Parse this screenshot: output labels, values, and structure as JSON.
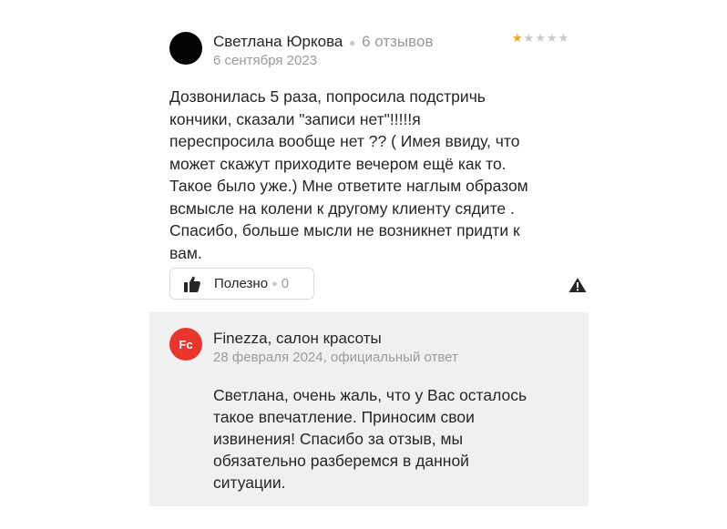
{
  "review": {
    "author_name": "Светлана Юркова",
    "review_count": "6 отзывов",
    "date": "6 сентября 2023",
    "rating": 1,
    "rating_max": 5,
    "text": "Дозвонилась 5 раза, попросила подстричь\nкончики, сказали \"записи нет\"!!!!!я\nпереспросила вообще нет ?? ( Имея ввиду, что\nможет скажут приходите вечером ещё как то.\nТакое было уже.) Мне ответите наглым образом\nвсмысле на колени к другому клиенту сядите .\nСпасибо, больше мысли не возникнет придти к\nвам.",
    "useful_label": "Полезно",
    "useful_count": "0",
    "icons": {
      "useful": "thumbs-up-icon",
      "report": "warning-triangle-icon"
    }
  },
  "reply": {
    "logo_text": "Fc",
    "business_name": "Finezza, салон красоты",
    "meta": "28 февраля 2024, официальный ответ",
    "text": "Светлана, очень жаль, что у Вас осталось\nтакое впечатление. Приносим свои\nизвинения! Спасибо за отзыв, мы\nобязательно разберемся в данной\nситуации."
  },
  "colors": {
    "star_filled": "#f6a31c",
    "star_empty": "#c9c9c9",
    "logo_bg": "#e8362d",
    "reply_bg": "#f0f0f0",
    "secondary_text": "#9a9a9a"
  }
}
